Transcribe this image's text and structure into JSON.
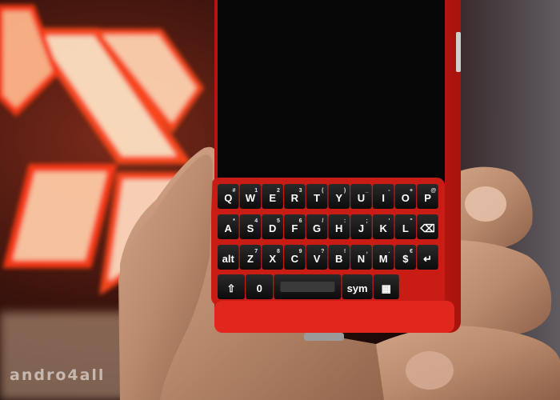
{
  "photo": {
    "subject": "red-qwerty-smartphone-in-hand",
    "colors": {
      "phone_body": "#d8231c",
      "keys": "#141414",
      "skin": "#b98a6c",
      "neon": "#ff5a2a"
    }
  },
  "keyboard": {
    "rows": [
      [
        {
          "main": "Q",
          "sub": "#"
        },
        {
          "main": "W",
          "sub": "1"
        },
        {
          "main": "E",
          "sub": "2"
        },
        {
          "main": "R",
          "sub": "3"
        },
        {
          "main": "T",
          "sub": "("
        },
        {
          "main": "Y",
          "sub": ")"
        },
        {
          "main": "U",
          "sub": "_"
        },
        {
          "main": "I",
          "sub": "-"
        },
        {
          "main": "O",
          "sub": "+"
        },
        {
          "main": "P",
          "sub": "@"
        }
      ],
      [
        {
          "main": "A",
          "sub": "*"
        },
        {
          "main": "S",
          "sub": "4"
        },
        {
          "main": "D",
          "sub": "5"
        },
        {
          "main": "F",
          "sub": "6"
        },
        {
          "main": "G",
          "sub": "/"
        },
        {
          "main": "H",
          "sub": ":"
        },
        {
          "main": "J",
          "sub": ";"
        },
        {
          "main": "K",
          "sub": "'"
        },
        {
          "main": "L",
          "sub": "\""
        },
        {
          "main": "⌫",
          "sub": ""
        }
      ],
      [
        {
          "main": "alt",
          "sub": ""
        },
        {
          "main": "Z",
          "sub": "7"
        },
        {
          "main": "X",
          "sub": "8"
        },
        {
          "main": "C",
          "sub": "9"
        },
        {
          "main": "V",
          "sub": "?"
        },
        {
          "main": "B",
          "sub": "!"
        },
        {
          "main": "N",
          "sub": ","
        },
        {
          "main": "M",
          "sub": "."
        },
        {
          "main": "$",
          "sub": "€"
        },
        {
          "main": "↵",
          "sub": ""
        }
      ],
      [
        {
          "main": "⇧",
          "sub": ""
        },
        {
          "main": "0",
          "sub": ""
        },
        {
          "main": "",
          "sub": ""
        },
        {
          "main": "sym",
          "sub": ""
        },
        {
          "main": "▦",
          "sub": ""
        }
      ]
    ]
  },
  "watermark": "andro4all"
}
